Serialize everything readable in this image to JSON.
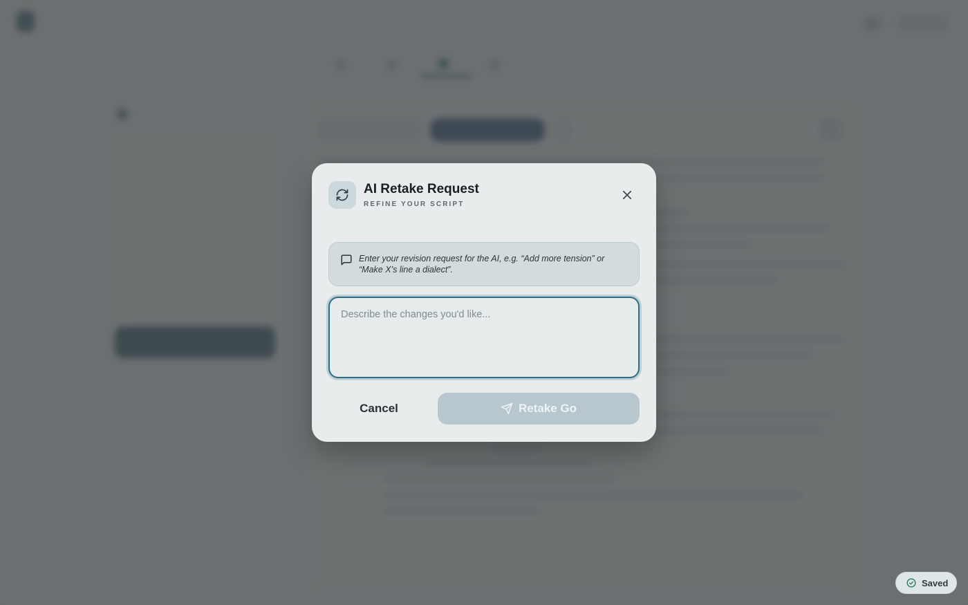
{
  "app": {
    "name": "",
    "subtitle": "",
    "project_prefix": "",
    "project_name": "",
    "account_label": ""
  },
  "tabs": [
    {
      "label": ""
    },
    {
      "label": ""
    },
    {
      "label": ""
    },
    {
      "label": ""
    }
  ],
  "sidebar": {
    "title": "",
    "items": [
      {
        "label": "",
        "count": ""
      },
      {
        "label": "",
        "count": ""
      },
      {
        "label": "",
        "count": ""
      },
      {
        "label": "",
        "count": ""
      },
      {
        "label": "",
        "count": ""
      },
      {
        "label": "",
        "count": ""
      }
    ],
    "action_label": ""
  },
  "editor": {
    "mode_label": "",
    "primary_label": "",
    "status_text": ""
  },
  "modal": {
    "title": "AI Retake Request",
    "subtitle": "REFINE YOUR SCRIPT",
    "hint": "Enter your revision request for the AI, e.g. “Add more tension” or “Make X’s line a dialect”.",
    "input_value": "",
    "input_placeholder": "Describe the changes you'd like...",
    "cancel_label": "Cancel",
    "submit_label": "Retake Go",
    "icons": {
      "header": "refresh-icon",
      "close": "close-icon",
      "hint": "message-square-icon",
      "submit": "send-icon"
    }
  },
  "toast": {
    "label": "Saved",
    "icon": "check-circle-icon"
  },
  "colors": {
    "accent": "#2a6e82",
    "modal_bg": "#e8eced",
    "submit_disabled": "#b7c7cd",
    "scrim": "#464a4c"
  }
}
